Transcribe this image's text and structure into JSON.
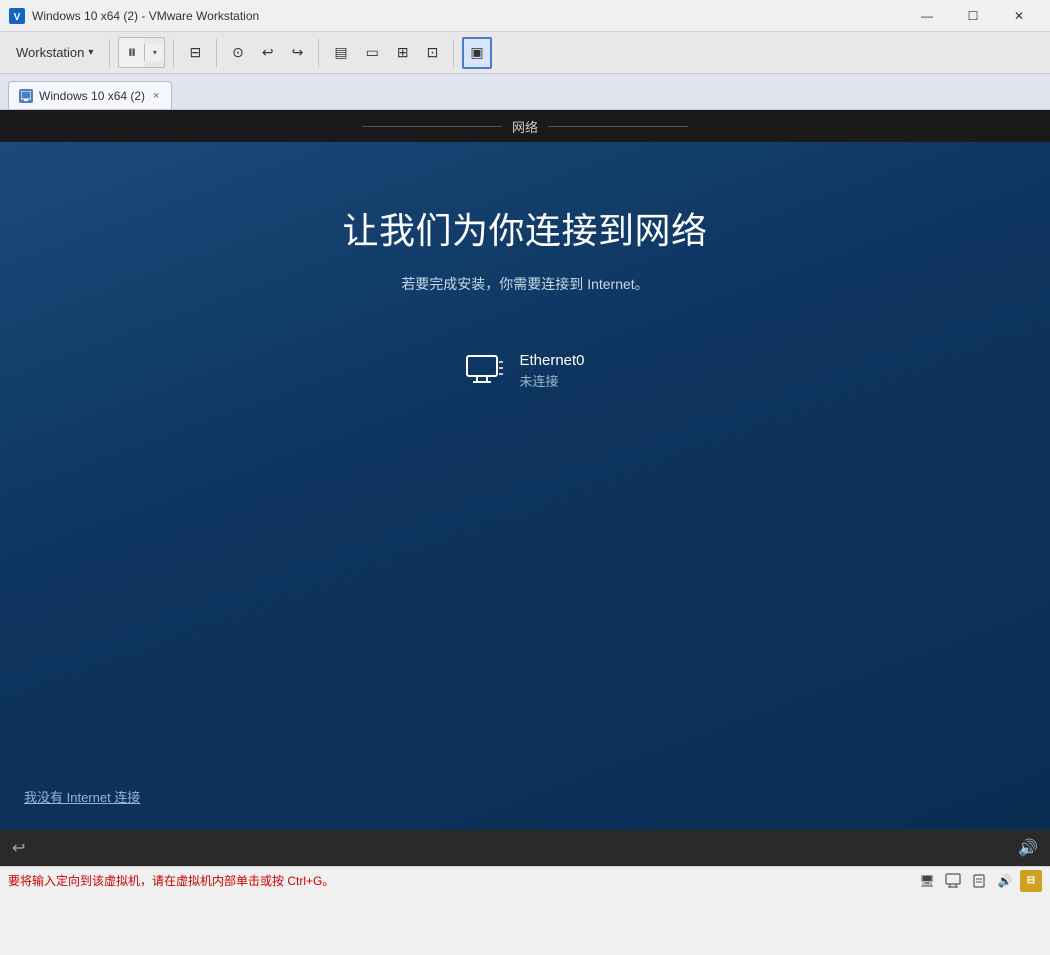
{
  "titleBar": {
    "icon": "vmware-icon",
    "title": "Windows 10 x64 (2) - VMware Workstation",
    "minimizeLabel": "—",
    "maximizeLabel": "☐",
    "closeLabel": "✕"
  },
  "toolbar": {
    "workstationLabel": "Workstation",
    "dropdownArrow": "▾",
    "powerIcon": "⏸",
    "snapshots": [
      {
        "label": "⊙",
        "tooltip": "snapshot"
      },
      {
        "label": "↩",
        "tooltip": "revert"
      },
      {
        "label": "↪",
        "tooltip": "clone"
      }
    ],
    "viewIcons": [
      {
        "label": "▤",
        "tooltip": "library"
      },
      {
        "label": "▭",
        "tooltip": "console"
      },
      {
        "label": "⊞",
        "tooltip": "tabs"
      },
      {
        "label": "⊡",
        "tooltip": "fullscreen"
      }
    ],
    "settingsIcon": "⚙",
    "activeViewIcon": "▣"
  },
  "tab": {
    "label": "Windows 10 x64 (2)",
    "closeLabel": "×"
  },
  "vmHeader": {
    "label": "网络"
  },
  "vmScreen": {
    "title": "让我们为你连接到网络",
    "subtitle": "若要完成安装，你需要连接到 Internet。",
    "networkAdapter": {
      "name": "Ethernet0",
      "status": "未连接"
    },
    "noInternetLabel": "我没有 Internet 连接"
  },
  "statusBar": {
    "text": "要将输入定向到该虚拟机，请在虚拟机内部单击或按 Ctrl+G。",
    "icons": [
      "🖥",
      "🔗",
      "🖨",
      "🔊",
      "📄"
    ]
  }
}
